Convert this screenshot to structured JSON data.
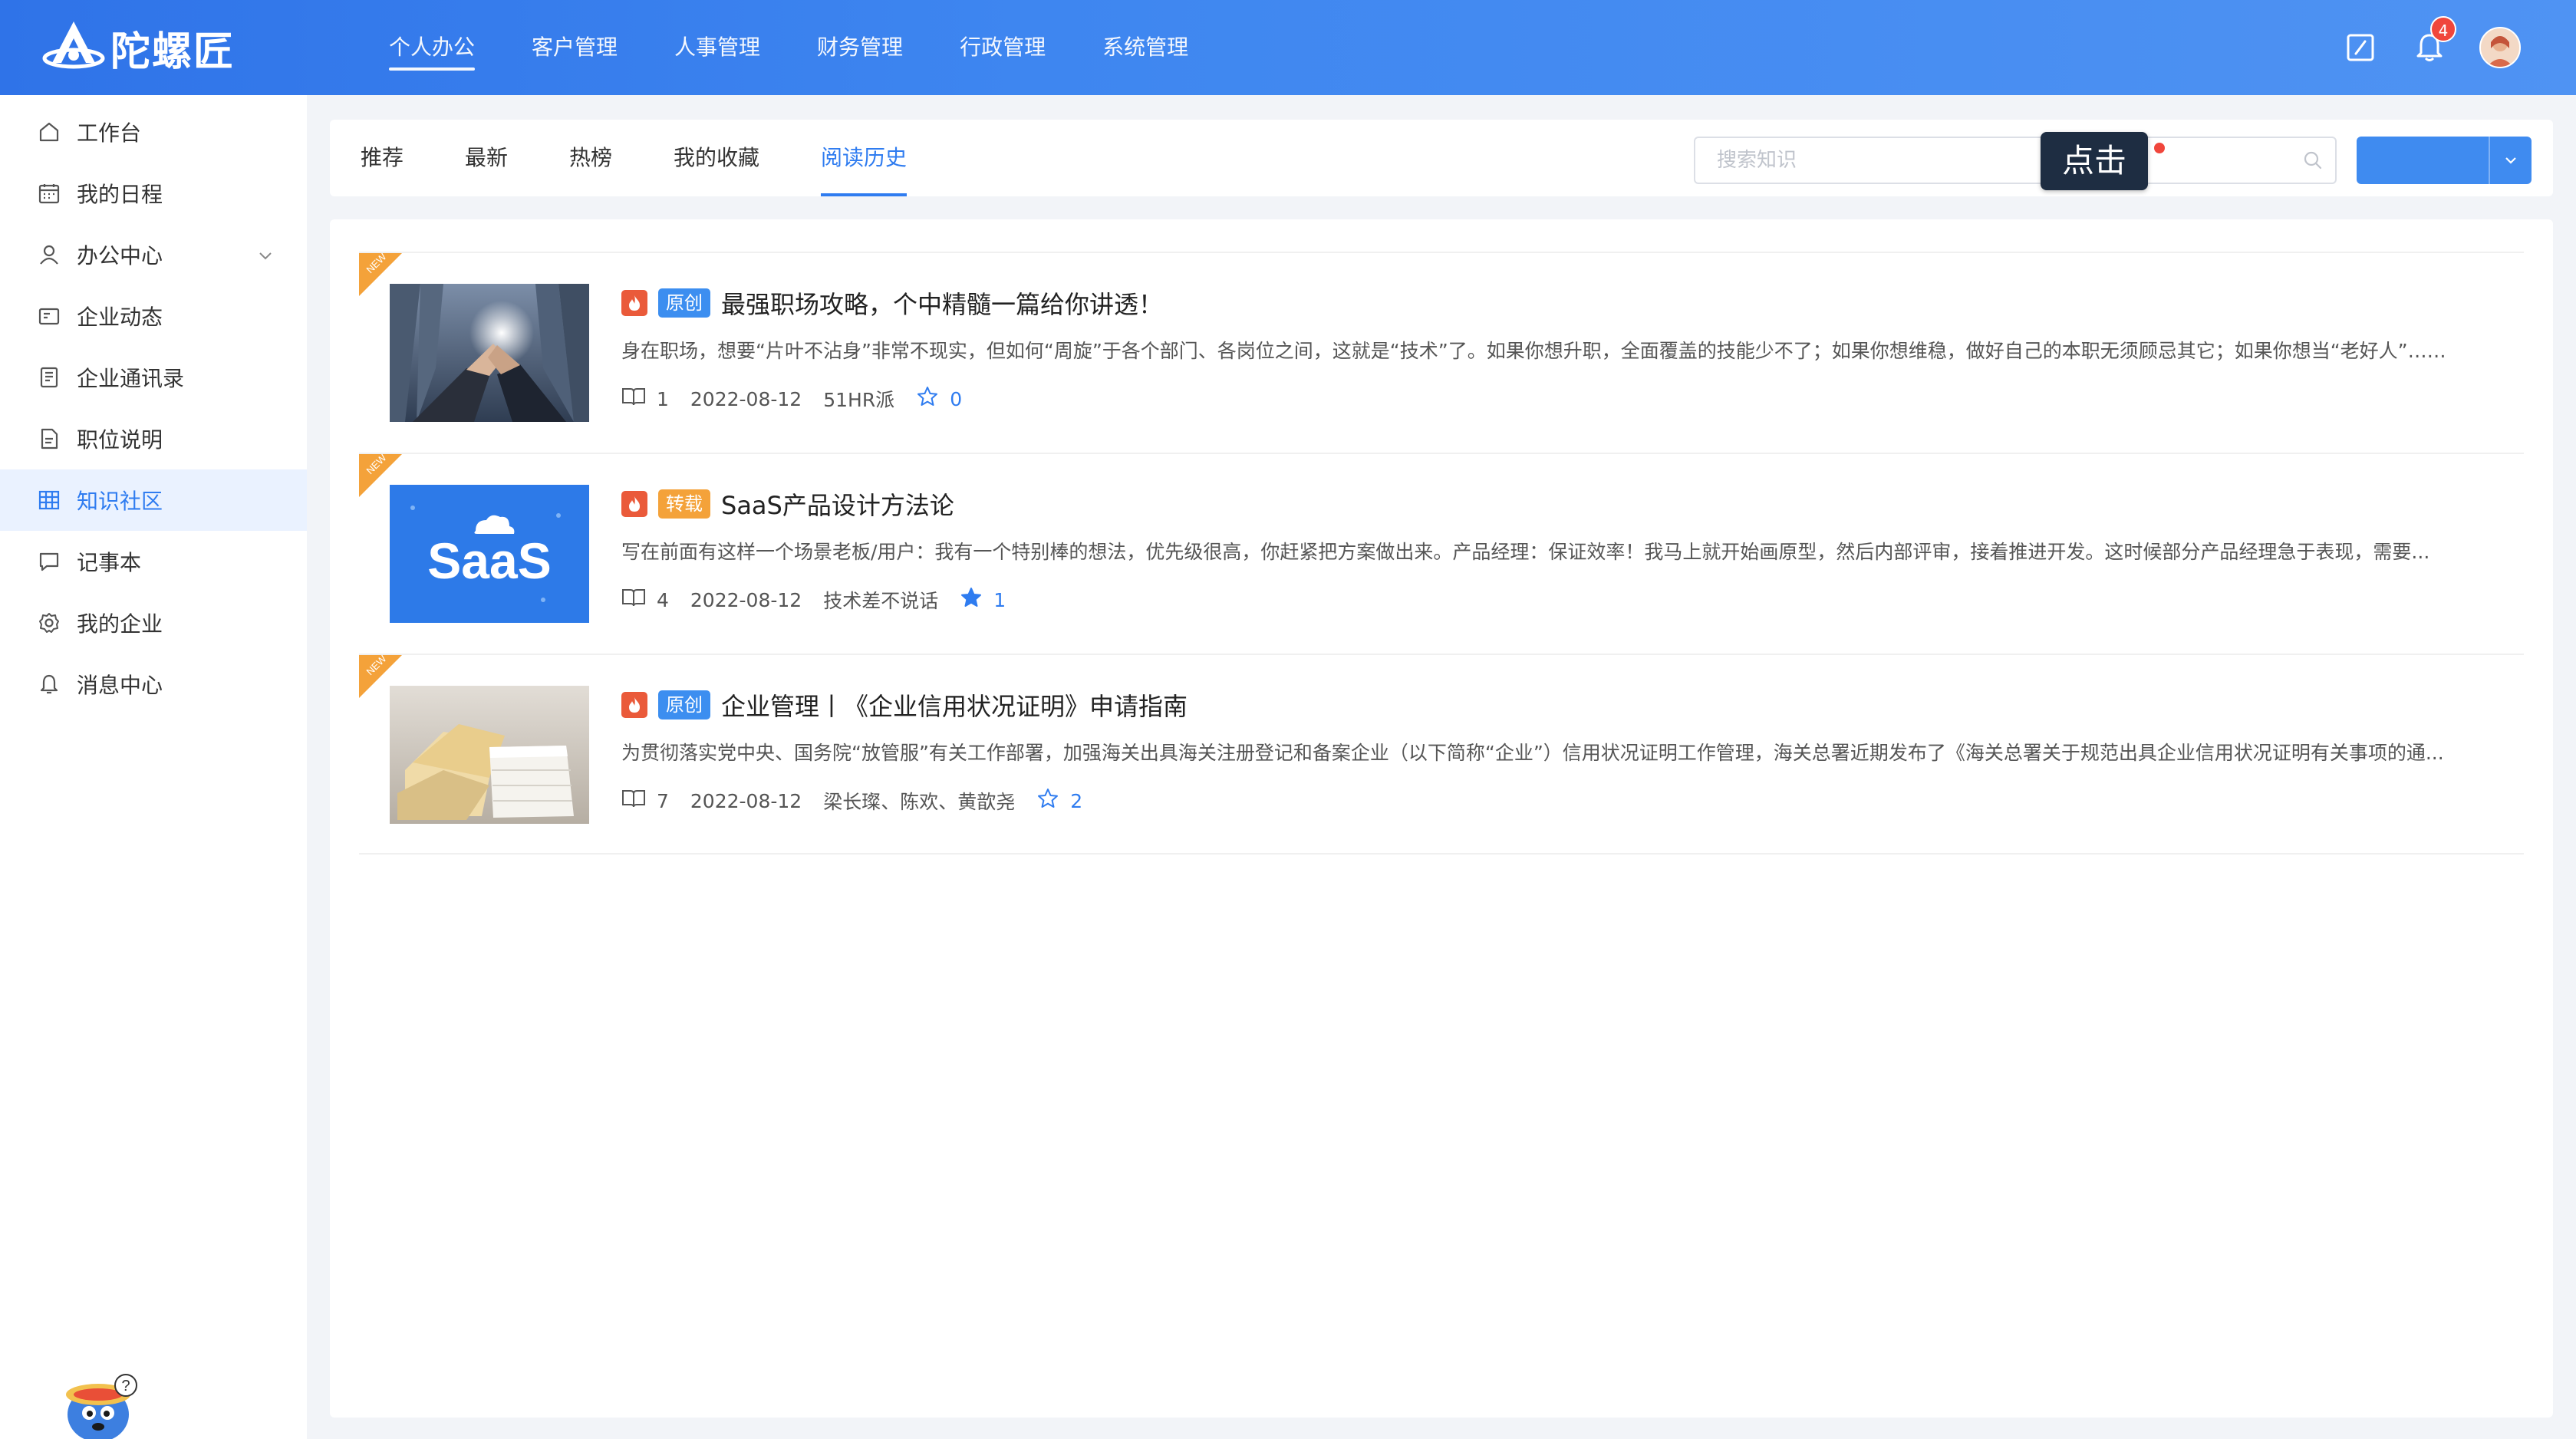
{
  "app": {
    "logo_text": "陀螺匠"
  },
  "topnav": {
    "items": [
      "个人办公",
      "客户管理",
      "人事管理",
      "财务管理",
      "行政管理",
      "系统管理"
    ],
    "active_index": 0
  },
  "header": {
    "notification_count": "4"
  },
  "sidebar": {
    "items": [
      {
        "label": "工作台",
        "icon": "home-icon"
      },
      {
        "label": "我的日程",
        "icon": "calendar-icon"
      },
      {
        "label": "办公中心",
        "icon": "user-icon",
        "has_submenu": true
      },
      {
        "label": "企业动态",
        "icon": "news-icon"
      },
      {
        "label": "企业通讯录",
        "icon": "contacts-icon"
      },
      {
        "label": "职位说明",
        "icon": "document-icon"
      },
      {
        "label": "知识社区",
        "icon": "grid-icon",
        "active": true
      },
      {
        "label": "记事本",
        "icon": "chat-icon"
      },
      {
        "label": "我的企业",
        "icon": "gear-icon"
      },
      {
        "label": "消息中心",
        "icon": "bell-icon"
      }
    ]
  },
  "tabs": {
    "items": [
      "推荐",
      "最新",
      "热榜",
      "我的收藏",
      "阅读历史"
    ],
    "active_index": 4
  },
  "search": {
    "placeholder": "搜索知识",
    "value": ""
  },
  "tooltip": {
    "label": "点击"
  },
  "articles": [
    {
      "badge": "NEW",
      "tag": "原创",
      "title": "最强职场攻略，个中精髓一篇给你讲透！",
      "summary": "身在职场，想要“片叶不沾身”非常不现实，但如何“周旋”于各个部门、各岗位之间，这就是“技术”了。如果你想升职，全面覆盖的技能少不了；如果你想维稳，做好自己的本职无须顾忌其它；如果你想当“老好人”……",
      "reads": "1",
      "date": "2022-08-12",
      "author": "51HR派",
      "favorites": "0",
      "favorited": false
    },
    {
      "badge": "NEW",
      "tag": "转载",
      "title": "SaaS产品设计方法论",
      "summary": "写在前面有这样一个场景老板/用户：我有一个特别棒的想法，优先级很高，你赶紧把方案做出来。产品经理：保证效率！我马上就开始画原型，然后内部评审，接着推进开发。这时候部分产品经理急于表现，需要...",
      "reads": "4",
      "date": "2022-08-12",
      "author": "技术差不说话",
      "favorites": "1",
      "favorited": true,
      "thumb_text": "SaaS"
    },
    {
      "badge": "NEW",
      "tag": "原创",
      "title": "企业管理丨《企业信用状况证明》申请指南",
      "summary": "为贯彻落实党中央、国务院“放管服”有关工作部署，加强海关出具海关注册登记和备案企业（以下简称“企业”）信用状况证明工作管理，海关总署近期发布了《海关总署关于规范出具企业信用状况证明有关事项的通...",
      "reads": "7",
      "date": "2022-08-12",
      "author": "梁长璨、陈欢、黄歆尧",
      "favorites": "2",
      "favorited": false
    }
  ],
  "colors": {
    "primary": "#2f7cf0",
    "topbar": "#3e86f0",
    "fire": "#ea5a3a",
    "repost": "#f4a23a",
    "new_badge": "#f4a23a"
  }
}
